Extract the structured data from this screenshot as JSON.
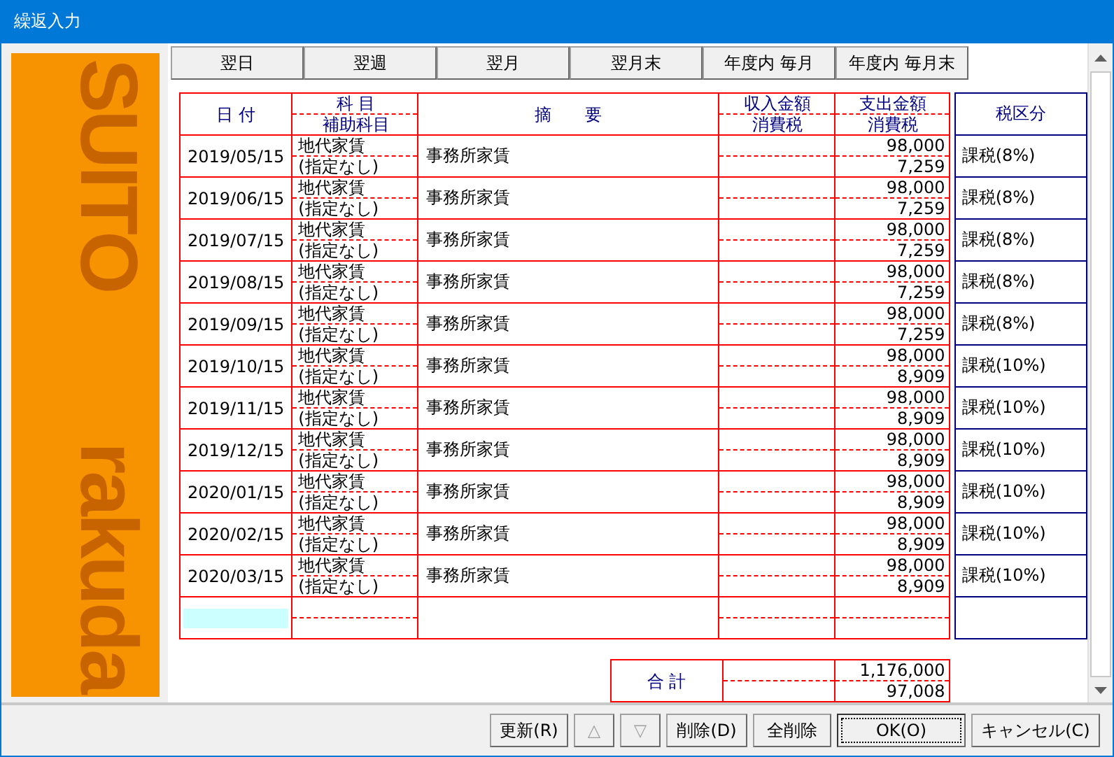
{
  "window": {
    "title": "繰返入力"
  },
  "logo": {
    "top": "SUITO",
    "bottom": "rakuda"
  },
  "repeat_buttons": [
    "翌日",
    "翌週",
    "翌月",
    "翌月末",
    "年度内 毎月",
    "年度内 毎月末"
  ],
  "table": {
    "columns": {
      "date": "日 付",
      "account": "科 目",
      "sub_account": "補助科目",
      "memo": "摘　　要",
      "income": "収入金額",
      "income_tax": "消費税",
      "expense": "支出金額",
      "expense_tax": "消費税",
      "tax_category": "税区分"
    },
    "rows": [
      {
        "date": "2019/05/15",
        "account": "地代家賃",
        "sub_account": "(指定なし)",
        "memo": "事務所家賃",
        "expense": "98,000",
        "tax": "7,259",
        "tax_category": "課税(8%)"
      },
      {
        "date": "2019/06/15",
        "account": "地代家賃",
        "sub_account": "(指定なし)",
        "memo": "事務所家賃",
        "expense": "98,000",
        "tax": "7,259",
        "tax_category": "課税(8%)"
      },
      {
        "date": "2019/07/15",
        "account": "地代家賃",
        "sub_account": "(指定なし)",
        "memo": "事務所家賃",
        "expense": "98,000",
        "tax": "7,259",
        "tax_category": "課税(8%)"
      },
      {
        "date": "2019/08/15",
        "account": "地代家賃",
        "sub_account": "(指定なし)",
        "memo": "事務所家賃",
        "expense": "98,000",
        "tax": "7,259",
        "tax_category": "課税(8%)"
      },
      {
        "date": "2019/09/15",
        "account": "地代家賃",
        "sub_account": "(指定なし)",
        "memo": "事務所家賃",
        "expense": "98,000",
        "tax": "7,259",
        "tax_category": "課税(8%)"
      },
      {
        "date": "2019/10/15",
        "account": "地代家賃",
        "sub_account": "(指定なし)",
        "memo": "事務所家賃",
        "expense": "98,000",
        "tax": "8,909",
        "tax_category": "課税(10%)"
      },
      {
        "date": "2019/11/15",
        "account": "地代家賃",
        "sub_account": "(指定なし)",
        "memo": "事務所家賃",
        "expense": "98,000",
        "tax": "8,909",
        "tax_category": "課税(10%)"
      },
      {
        "date": "2019/12/15",
        "account": "地代家賃",
        "sub_account": "(指定なし)",
        "memo": "事務所家賃",
        "expense": "98,000",
        "tax": "8,909",
        "tax_category": "課税(10%)"
      },
      {
        "date": "2020/01/15",
        "account": "地代家賃",
        "sub_account": "(指定なし)",
        "memo": "事務所家賃",
        "expense": "98,000",
        "tax": "8,909",
        "tax_category": "課税(10%)"
      },
      {
        "date": "2020/02/15",
        "account": "地代家賃",
        "sub_account": "(指定なし)",
        "memo": "事務所家賃",
        "expense": "98,000",
        "tax": "8,909",
        "tax_category": "課税(10%)"
      },
      {
        "date": "2020/03/15",
        "account": "地代家賃",
        "sub_account": "(指定なし)",
        "memo": "事務所家賃",
        "expense": "98,000",
        "tax": "8,909",
        "tax_category": "課税(10%)"
      }
    ],
    "new_row": {
      "selected": true
    },
    "total": {
      "label": "合 計",
      "expense": "1,176,000",
      "tax": "97,008"
    }
  },
  "buttons": [
    {
      "label": "更新(R)",
      "disabled": false,
      "default": false
    },
    {
      "label": "△",
      "disabled": true,
      "default": false
    },
    {
      "label": "▽",
      "disabled": true,
      "default": false
    },
    {
      "label": "削除(D)",
      "disabled": false,
      "default": false
    },
    {
      "label": "全削除",
      "disabled": false,
      "default": false
    },
    {
      "label": "OK(O)",
      "disabled": false,
      "default": true
    },
    {
      "label": "キャンセル(C)",
      "disabled": false,
      "default": false
    }
  ]
}
